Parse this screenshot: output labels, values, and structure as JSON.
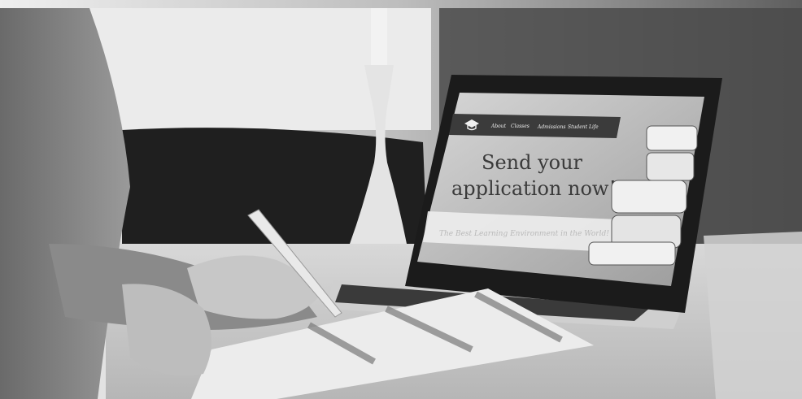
{
  "laptop_screen": {
    "nav_items": [
      "About",
      "Classes",
      "Admissions",
      "Student Life"
    ],
    "headline_line1": "Send your",
    "headline_line2": "application now!",
    "tagline": "The Best Learning Environment in the World!"
  },
  "icons": {
    "logo": "graduation-cap-icon"
  },
  "colors": {
    "background_wall": "#6f6f6f",
    "window_light": "#e9e9e9",
    "sofa": "#1e1e1e",
    "desk": "#c9c9c9",
    "laptop_bezel": "#1b1b1b",
    "screen_nav": "#3b3b3b",
    "paper": "#ececec"
  }
}
